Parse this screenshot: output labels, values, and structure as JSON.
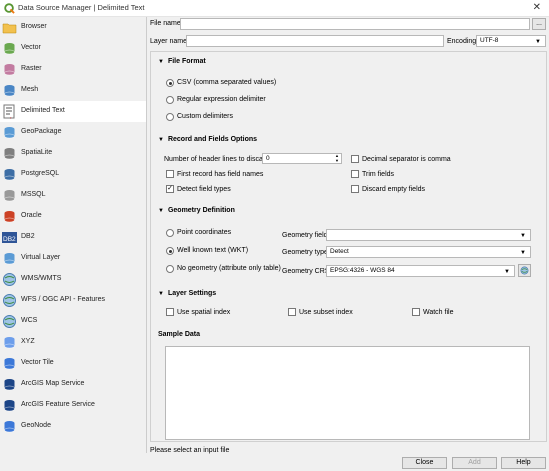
{
  "window": {
    "title": "Data Source Manager | Delimited Text",
    "close_glyph": "✕"
  },
  "sidebar": {
    "items": [
      {
        "label": "Browser",
        "icon": "folder-icon"
      },
      {
        "label": "Vector",
        "icon": "vector-icon"
      },
      {
        "label": "Raster",
        "icon": "raster-icon"
      },
      {
        "label": "Mesh",
        "icon": "mesh-icon"
      },
      {
        "label": "Delimited Text",
        "icon": "delimited-text-icon"
      },
      {
        "label": "GeoPackage",
        "icon": "geopackage-icon"
      },
      {
        "label": "SpatiaLite",
        "icon": "spatialite-icon"
      },
      {
        "label": "PostgreSQL",
        "icon": "postgresql-icon"
      },
      {
        "label": "MSSQL",
        "icon": "mssql-icon"
      },
      {
        "label": "Oracle",
        "icon": "oracle-icon"
      },
      {
        "label": "DB2",
        "icon": "db2-icon"
      },
      {
        "label": "Virtual Layer",
        "icon": "virtual-layer-icon"
      },
      {
        "label": "WMS/WMTS",
        "icon": "globe-icon"
      },
      {
        "label": "WFS / OGC API - Features",
        "icon": "globe-icon"
      },
      {
        "label": "WCS",
        "icon": "globe-icon"
      },
      {
        "label": "XYZ",
        "icon": "xyz-icon"
      },
      {
        "label": "Vector Tile",
        "icon": "vector-tile-icon"
      },
      {
        "label": "ArcGIS Map Service",
        "icon": "arcgis-icon"
      },
      {
        "label": "ArcGIS Feature Service",
        "icon": "arcgis-icon"
      },
      {
        "label": "GeoNode",
        "icon": "geonode-icon"
      }
    ]
  },
  "file": {
    "label": "File name",
    "value": "",
    "browse": "..."
  },
  "layer": {
    "label": "Layer name",
    "value": "",
    "encoding_label": "Encoding",
    "encoding": "UTF-8"
  },
  "file_format": {
    "title": "File Format",
    "options": [
      "CSV (comma separated values)",
      "Regular expression delimiter",
      "Custom delimiters"
    ]
  },
  "records": {
    "title": "Record and Fields Options",
    "header_lines_label": "Number of header lines to discard",
    "header_lines_value": "0",
    "first_record": "First record has field names",
    "detect_types": "Detect field types",
    "decimal_comma": "Decimal separator is comma",
    "trim_fields": "Trim fields",
    "discard_empty": "Discard empty fields"
  },
  "geometry": {
    "title": "Geometry Definition",
    "options": [
      "Point coordinates",
      "Well known text (WKT)",
      "No geometry (attribute only table)"
    ],
    "field_label": "Geometry field",
    "field_value": "",
    "type_label": "Geometry type",
    "type_value": "Detect",
    "crs_label": "Geometry CRS",
    "crs_value": "EPSG:4326 - WGS 84"
  },
  "layer_settings": {
    "title": "Layer Settings",
    "spatial_index": "Use spatial index",
    "subset_index": "Use subset index",
    "watch_file": "Watch file"
  },
  "sample": {
    "title": "Sample Data"
  },
  "status": {
    "text": "Please select an input file"
  },
  "buttons": {
    "close": "Close",
    "add": "Add",
    "help": "Help"
  },
  "colors": {
    "selected_bg": "#ffffff",
    "sidebar_bg": "#f0f0f0",
    "accent": "#589632"
  }
}
